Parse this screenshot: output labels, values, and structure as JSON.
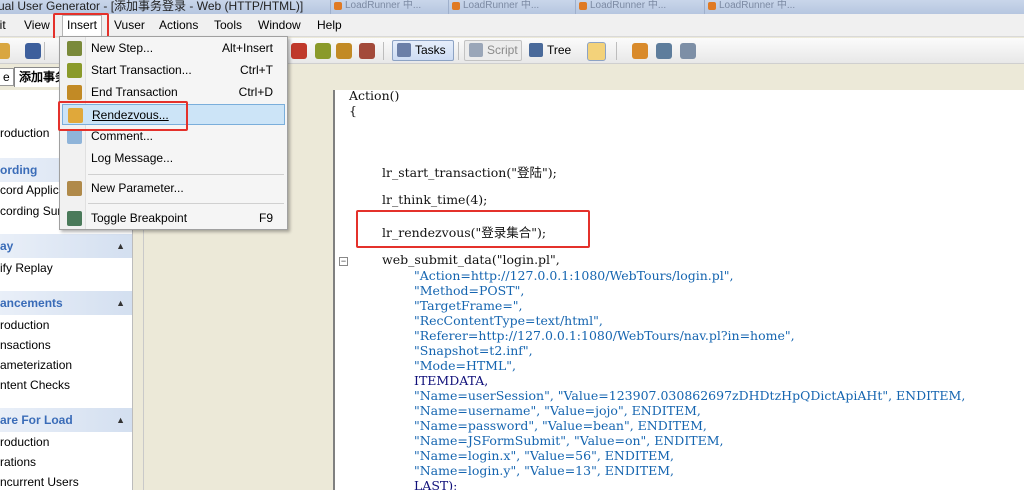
{
  "window": {
    "title": "ual User Generator - [添加事务登录 - Web (HTTP/HTML)]",
    "bg_tabs": [
      "LoadRunner 中...",
      "LoadRunner 中...",
      "LoadRunner 中...",
      "LoadRunner 中..."
    ]
  },
  "menubar": {
    "items": [
      "lit",
      "View",
      "Insert",
      "Vuser",
      "Actions",
      "Tools",
      "Window",
      "Help"
    ]
  },
  "toolbar": {
    "tasks_label": "Tasks",
    "script_label": "Script",
    "tree_label": "Tree"
  },
  "tabs": {
    "first": "e",
    "second": "添加事务"
  },
  "insert_menu": {
    "items": [
      {
        "label": "New Step...",
        "shortcut": "Alt+Insert",
        "icon": "new-step-icon"
      },
      {
        "label": "Start Transaction...",
        "shortcut": "Ctrl+T",
        "icon": "start-transaction-icon"
      },
      {
        "label": "End Transaction",
        "shortcut": "Ctrl+D",
        "icon": "end-transaction-icon"
      },
      {
        "label": "Rendezvous...",
        "shortcut": "",
        "icon": "rendezvous-icon"
      },
      {
        "label": "Comment...",
        "shortcut": "",
        "icon": "comment-icon"
      },
      {
        "label": "Log Message...",
        "shortcut": "",
        "icon": ""
      },
      {
        "label": "New Parameter...",
        "shortcut": "",
        "icon": "parameter-icon"
      },
      {
        "label": "Toggle Breakpoint",
        "shortcut": "F9",
        "icon": "breakpoint-icon"
      }
    ]
  },
  "tasks_pane": {
    "intro": "roduction",
    "groups": [
      {
        "title": "ording",
        "items": [
          "cord Applica",
          "cording Sum"
        ]
      },
      {
        "title": "ay",
        "items": [
          "ify Replay"
        ]
      },
      {
        "title": "ancements",
        "items": [
          "roduction",
          "nsactions",
          "ameterization",
          "ntent Checks"
        ]
      },
      {
        "title": "are For Load",
        "items": [
          "roduction",
          "rations",
          "ncurrent Users"
        ]
      }
    ]
  },
  "editor": {
    "lines": [
      "Action()",
      "{",
      "lr_start_transaction(\"登陆\");",
      "lr_think_time(4);",
      "lr_rendezvous(\"登录集合\");",
      "web_submit_data(\"login.pl\",",
      "\"Action=http://127.0.0.1:1080/WebTours/login.pl\",",
      "\"Method=POST\",",
      "\"TargetFrame=\",",
      "\"RecContentType=text/html\",",
      "\"Referer=http://127.0.0.1:1080/WebTours/nav.pl?in=home\",",
      "\"Snapshot=t2.inf\",",
      "\"Mode=HTML\",",
      "ITEMDATA,",
      "\"Name=userSession\", \"Value=123907.030862697zDHDtzHpQDictApiAHt\", ENDITEM,",
      "\"Name=username\", \"Value=jojo\", ENDITEM,",
      "\"Name=password\", \"Value=bean\", ENDITEM,",
      "\"Name=JSFormSubmit\", \"Value=on\", ENDITEM,",
      "\"Name=login.x\", \"Value=56\", ENDITEM,",
      "\"Name=login.y\", \"Value=13\", ENDITEM,",
      "LAST);"
    ]
  },
  "colors": {
    "highlight_box": "#e4312b",
    "menu_selected": "#cce4f7",
    "task_header_text": "#3a6cb8",
    "string_literal": "#1565b0"
  }
}
